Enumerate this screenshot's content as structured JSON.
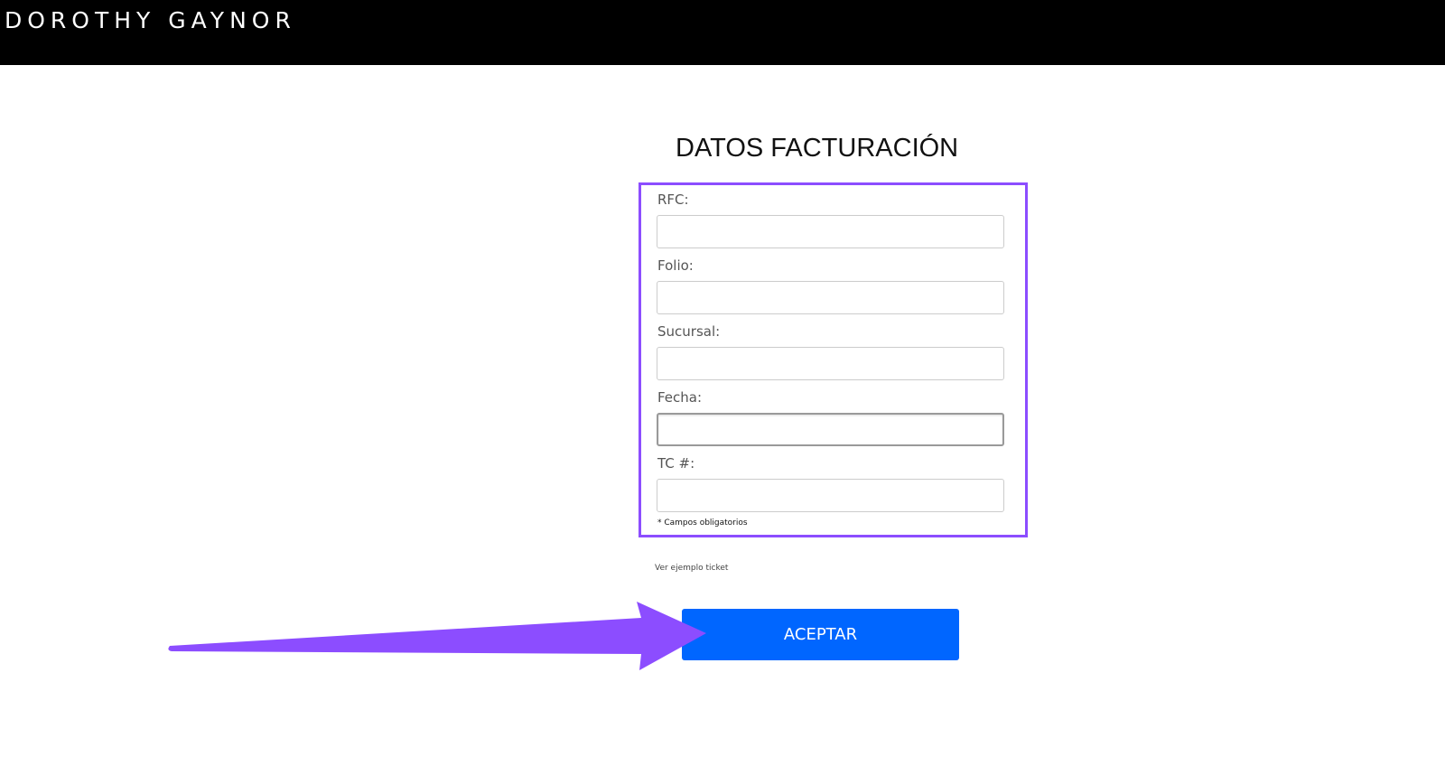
{
  "header": {
    "brand": "DOROTHY GAYNOR",
    "background": "#000000"
  },
  "form": {
    "title": "DATOS FACTURACIÓN",
    "fields": [
      {
        "label": "RFC:",
        "value": ""
      },
      {
        "label": "Folio:",
        "value": ""
      },
      {
        "label": "Sucursal:",
        "value": ""
      },
      {
        "label": "Fecha:",
        "value": ""
      },
      {
        "label": "TC #:",
        "value": ""
      }
    ],
    "required_note": "* Campos obligatorios",
    "highlight_color": "#8c4dff"
  },
  "example_link": "Ver ejemplo ticket",
  "accept_button": {
    "label": "ACEPTAR",
    "color": "#0066ff"
  },
  "annotation": {
    "arrow_color": "#8c4dff",
    "icon": "arrow-right-icon"
  }
}
